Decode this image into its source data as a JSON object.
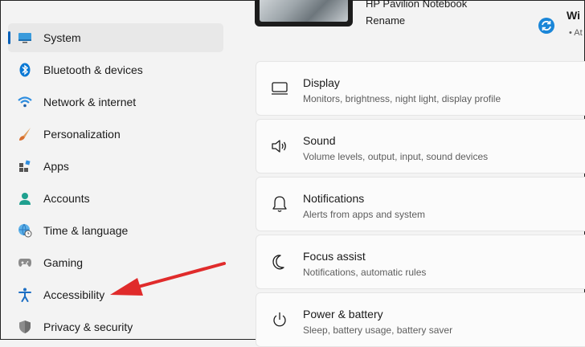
{
  "device": {
    "name": "HP Pavilion Notebook",
    "rename_label": "Rename"
  },
  "windows_update": {
    "title": "Wi",
    "status": "• At"
  },
  "sidebar": {
    "items": [
      {
        "label": "System",
        "icon": "monitor-icon",
        "active": true
      },
      {
        "label": "Bluetooth & devices",
        "icon": "bluetooth-icon"
      },
      {
        "label": "Network & internet",
        "icon": "wifi-icon"
      },
      {
        "label": "Personalization",
        "icon": "brush-icon"
      },
      {
        "label": "Apps",
        "icon": "apps-icon"
      },
      {
        "label": "Accounts",
        "icon": "person-icon"
      },
      {
        "label": "Time & language",
        "icon": "globe-clock-icon"
      },
      {
        "label": "Gaming",
        "icon": "gamepad-icon"
      },
      {
        "label": "Accessibility",
        "icon": "accessibility-icon"
      },
      {
        "label": "Privacy & security",
        "icon": "shield-icon"
      }
    ]
  },
  "settings": {
    "cards": [
      {
        "title": "Display",
        "subtitle": "Monitors, brightness, night light, display profile",
        "icon": "display-icon"
      },
      {
        "title": "Sound",
        "subtitle": "Volume levels, output, input, sound devices",
        "icon": "speaker-icon"
      },
      {
        "title": "Notifications",
        "subtitle": "Alerts from apps and system",
        "icon": "bell-icon"
      },
      {
        "title": "Focus assist",
        "subtitle": "Notifications, automatic rules",
        "icon": "moon-icon"
      },
      {
        "title": "Power & battery",
        "subtitle": "Sleep, battery usage, battery saver",
        "icon": "power-icon"
      }
    ]
  },
  "colors": {
    "accent": "#005fb8",
    "annotation_arrow": "#e02b2b"
  }
}
